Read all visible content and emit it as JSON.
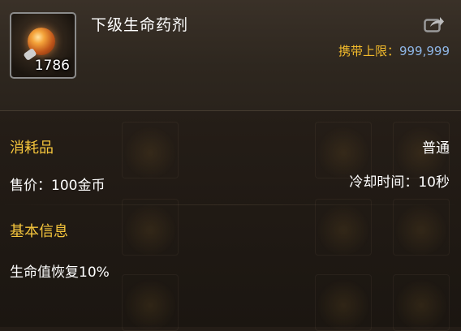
{
  "item": {
    "name": "下级生命药剂",
    "stack_count": "1786",
    "icon": "orange-potion-icon",
    "carry_limit_label": "携带上限：",
    "carry_limit_value": "999,999"
  },
  "details": {
    "category": "消耗品",
    "rarity": "普通",
    "price": "售价：100金币",
    "cooldown": "冷却时间：10秒"
  },
  "basic_info": {
    "title": "基本信息",
    "effect": "生命值恢复10%"
  },
  "colors": {
    "section_title": "#f5c53c",
    "carry_label": "#f3bb2c",
    "carry_value": "#8eb5e5",
    "text": "#ffffff"
  },
  "icons": {
    "share": "share-export-icon"
  }
}
